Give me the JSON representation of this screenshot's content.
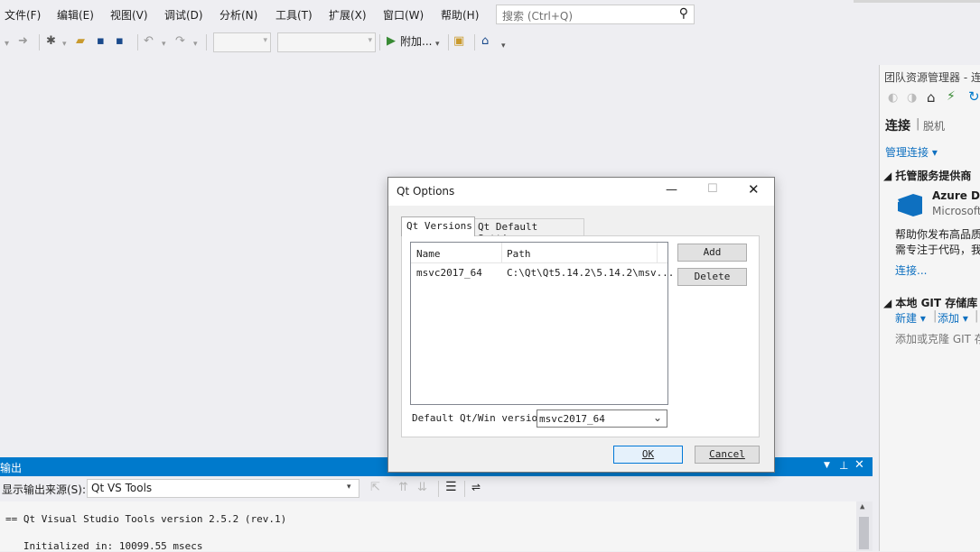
{
  "menu": [
    "文件(F)",
    "编辑(E)",
    "视图(V)",
    "调试(D)",
    "分析(N)",
    "工具(T)",
    "扩展(X)",
    "窗口(W)",
    "帮助(H)"
  ],
  "search": {
    "placeholder": "搜索 (Ctrl+Q)"
  },
  "toolbar": {
    "attach_label": "附加..."
  },
  "team_explorer": {
    "title": "团队资源管理器 - 连",
    "tab_connect": "连接",
    "tab_sep": "|",
    "tab_offline": "脱机",
    "manage_connections": "管理连接",
    "hosted_section": "托管服务提供商",
    "azure_title": "Azure De",
    "azure_sub": "Microsoft",
    "azure_desc1": "帮助你发布高品质",
    "azure_desc2": "需专注于代码，我",
    "connect_link": "连接...",
    "local_git_section": "本地 GIT 存储库",
    "new_label": "新建",
    "add_label": "添加",
    "clone_hint": "添加或克隆 GIT 存"
  },
  "output": {
    "title": "输出",
    "source_label": "显示输出来源(S):",
    "source_value": "Qt VS Tools",
    "line1": "== Qt Visual Studio Tools version 2.5.2 (rev.1)",
    "line2": "   Initialized in: 10099.55 msecs"
  },
  "dialog": {
    "title": "Qt Options",
    "tabs": [
      "Qt Versions",
      "Qt Default Settings"
    ],
    "columns": [
      "Name",
      "Path"
    ],
    "rows": [
      {
        "name": "msvc2017_64",
        "path": "C:\\Qt\\Qt5.14.2\\5.14.2\\msv..."
      }
    ],
    "add": "Add",
    "delete": "Delete",
    "default_label": "Default Qt/Win version:",
    "default_value": "msvc2017_64",
    "ok": "OK",
    "cancel": "Cancel"
  },
  "colors": {
    "accent": "#007acc",
    "play": "#388a34"
  }
}
